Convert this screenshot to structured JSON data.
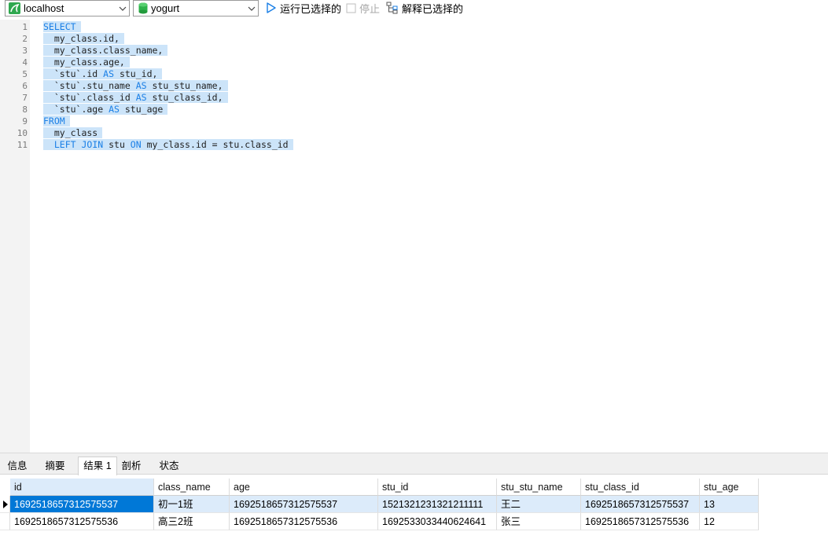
{
  "toolbar": {
    "connection": "localhost",
    "database": "yogurt",
    "run_selected": "运行已选择的",
    "stop": "停止",
    "explain_selected": "解释已选择的"
  },
  "editor": {
    "lines": [
      {
        "num": "1",
        "parts": [
          {
            "t": "SELECT",
            "k": true
          }
        ]
      },
      {
        "num": "2",
        "parts": [
          {
            "t": "  my_class.id,",
            "k": false
          }
        ]
      },
      {
        "num": "3",
        "parts": [
          {
            "t": "  my_class.class_name,",
            "k": false
          }
        ]
      },
      {
        "num": "4",
        "parts": [
          {
            "t": "  my_class.age,",
            "k": false
          }
        ]
      },
      {
        "num": "5",
        "parts": [
          {
            "t": "  `stu`.id ",
            "k": false
          },
          {
            "t": "AS",
            "k": true
          },
          {
            "t": " stu_id,",
            "k": false
          }
        ]
      },
      {
        "num": "6",
        "parts": [
          {
            "t": "  `stu`.stu_name ",
            "k": false
          },
          {
            "t": "AS",
            "k": true
          },
          {
            "t": " stu_stu_name,",
            "k": false
          }
        ]
      },
      {
        "num": "7",
        "parts": [
          {
            "t": "  `stu`.class_id ",
            "k": false
          },
          {
            "t": "AS",
            "k": true
          },
          {
            "t": " stu_class_id,",
            "k": false
          }
        ]
      },
      {
        "num": "8",
        "parts": [
          {
            "t": "  `stu`.age ",
            "k": false
          },
          {
            "t": "AS",
            "k": true
          },
          {
            "t": " stu_age",
            "k": false
          }
        ]
      },
      {
        "num": "9",
        "parts": [
          {
            "t": "FROM",
            "k": true
          }
        ]
      },
      {
        "num": "10",
        "parts": [
          {
            "t": "  my_class",
            "k": false
          }
        ]
      },
      {
        "num": "11",
        "parts": [
          {
            "t": "  ",
            "k": false
          },
          {
            "t": "LEFT JOIN",
            "k": true
          },
          {
            "t": " stu ",
            "k": false
          },
          {
            "t": "ON",
            "k": true
          },
          {
            "t": " my_class.id = stu.class_id",
            "k": false
          }
        ]
      }
    ]
  },
  "tabs": [
    "信息",
    "摘要",
    "结果 1",
    "剖析",
    "状态"
  ],
  "active_tab": "结果 1",
  "grid": {
    "columns": [
      "id",
      "class_name",
      "age",
      "stu_id",
      "stu_stu_name",
      "stu_class_id",
      "stu_age"
    ],
    "rows": [
      [
        "1692518657312575537",
        "初一1班",
        "1692518657312575537",
        "1521321231321211111",
        "王二",
        "1692518657312575537",
        "13"
      ],
      [
        "1692518657312575536",
        "高三2班",
        "1692518657312575536",
        "1692533033440624641",
        "张三",
        "1692518657312575536",
        "12"
      ]
    ]
  },
  "colors": {
    "keyword": "#1a7fe6",
    "selection": "#cce4f9",
    "focused_cell": "#0078d7",
    "selected_row": "#dcebfa"
  },
  "icons": {
    "connection": "mysql-dolphin-icon",
    "database": "database-cylinder-icon",
    "run": "play-icon",
    "stop": "stop-icon",
    "explain": "explain-icon"
  }
}
